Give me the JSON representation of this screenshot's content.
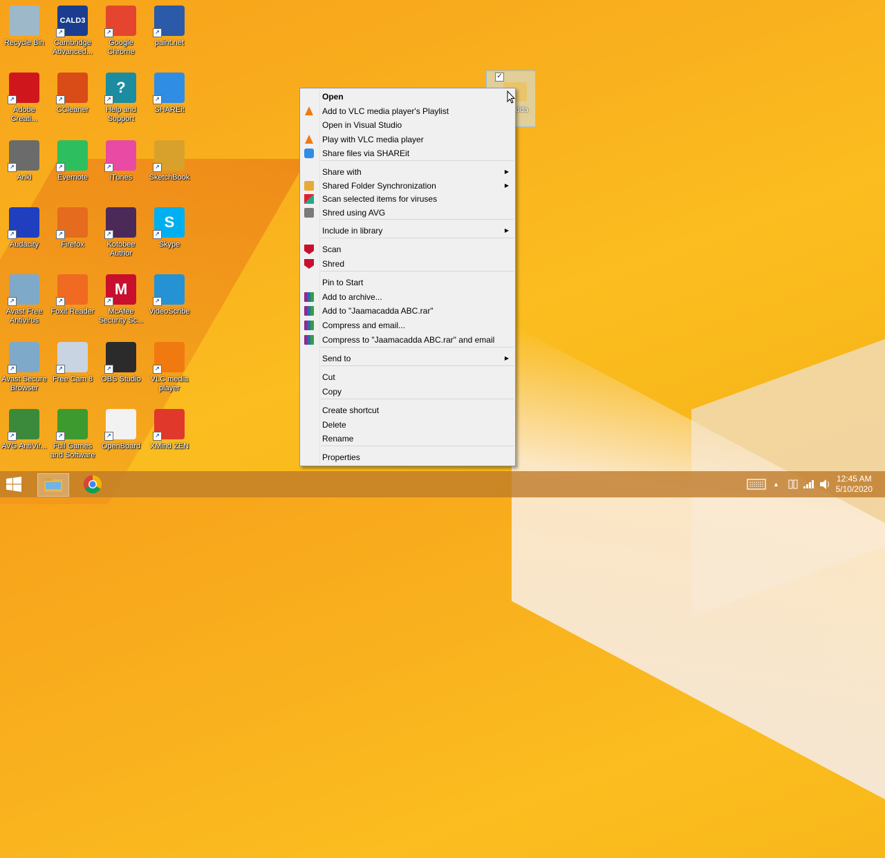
{
  "desktop": {
    "icons": [
      {
        "label": "Recycle Bin",
        "icon": "recycle-bin-icon",
        "color": "#9db8c9"
      },
      {
        "label": "Cambridge Advanced...",
        "icon": "cald3-icon",
        "color": "#1a3d8f",
        "badge": "CALD3"
      },
      {
        "label": "Google Chrome",
        "icon": "chrome-icon",
        "color": "#e5452f"
      },
      {
        "label": "paint.net",
        "icon": "paintnet-icon",
        "color": "#2a5aa8"
      },
      {
        "label": "Adobe Creati...",
        "icon": "adobe-cc-icon",
        "color": "#d0161d"
      },
      {
        "label": "CCleaner",
        "icon": "ccleaner-icon",
        "color": "#d94b17"
      },
      {
        "label": "Help and Support",
        "icon": "help-icon",
        "color": "#1c8ca0",
        "badge": "?"
      },
      {
        "label": "SHAREit",
        "icon": "shareit-icon",
        "color": "#2f8de4"
      },
      {
        "label": "Anki",
        "icon": "anki-icon",
        "color": "#6b6b6b"
      },
      {
        "label": "Evernote",
        "icon": "evernote-icon",
        "color": "#2dbe60"
      },
      {
        "label": "iTunes",
        "icon": "itunes-icon",
        "color": "#e94aa3"
      },
      {
        "label": "SketchBook",
        "icon": "sketchbook-icon",
        "color": "#d8a12b"
      },
      {
        "label": "Audacity",
        "icon": "audacity-icon",
        "color": "#1f3fbf"
      },
      {
        "label": "Firefox",
        "icon": "firefox-icon",
        "color": "#e56b1e"
      },
      {
        "label": "Kotobee Author",
        "icon": "kotobee-icon",
        "color": "#4b2a5a"
      },
      {
        "label": "Skype",
        "icon": "skype-icon",
        "color": "#00aff0",
        "badge": "S"
      },
      {
        "label": "Avast Free Antivirus",
        "icon": "avast-icon",
        "color": "#7fa9c9"
      },
      {
        "label": "Foxit Reader",
        "icon": "foxit-icon",
        "color": "#f06b21"
      },
      {
        "label": "McAfee Security Sc...",
        "icon": "mcafee-icon",
        "color": "#c8102e",
        "badge": "M"
      },
      {
        "label": "VideoScribe",
        "icon": "videoscribe-icon",
        "color": "#2592d3"
      },
      {
        "label": "Avast Secure Browser",
        "icon": "avast-browser-icon",
        "color": "#7fa9c9"
      },
      {
        "label": "Free Cam 8",
        "icon": "freecam-icon",
        "color": "#c8d4e2"
      },
      {
        "label": "OBS Studio",
        "icon": "obs-icon",
        "color": "#2b2b2b"
      },
      {
        "label": "VLC media player",
        "icon": "vlc-icon",
        "color": "#f07a10"
      },
      {
        "label": "AVG AntiVir...",
        "icon": "avg-icon",
        "color": "#3b8a3b"
      },
      {
        "label": "Full Games and Software",
        "icon": "games-icon",
        "color": "#3d9a2e"
      },
      {
        "label": "OpenBoard",
        "icon": "openboard-icon",
        "color": "#f2f2f2"
      },
      {
        "label": "XMind ZEN",
        "icon": "xmind-icon",
        "color": "#e0382b"
      }
    ],
    "selected_file": {
      "label": "cadda",
      "checked": "✓"
    }
  },
  "context_menu": {
    "items": [
      {
        "label": "Open",
        "bold": true,
        "icon": ""
      },
      {
        "label": "Add to VLC media player's Playlist",
        "icon": "vlc-icon"
      },
      {
        "label": "Open in Visual Studio",
        "icon": ""
      },
      {
        "label": "Play with VLC media player",
        "icon": "vlc-icon"
      },
      {
        "label": "Share files via SHAREit",
        "icon": "shareit-icon"
      },
      {
        "label": "Share with",
        "icon": "",
        "submenu": true
      },
      {
        "label": "Shared Folder Synchronization",
        "icon": "folder-sync-icon",
        "submenu": true
      },
      {
        "label": "Scan selected items for viruses",
        "icon": "avast-scan-icon"
      },
      {
        "label": "Shred using AVG",
        "icon": "shredder-icon"
      },
      {
        "label": "Include in library",
        "icon": "",
        "submenu": true
      },
      {
        "label": "Scan",
        "icon": "mcafee-icon"
      },
      {
        "label": "Shred",
        "icon": "mcafee-icon"
      },
      {
        "label": "Pin to Start",
        "icon": ""
      },
      {
        "label": "Add to archive...",
        "icon": "winrar-icon"
      },
      {
        "label": "Add to \"Jaamacadda ABC.rar\"",
        "icon": "winrar-icon"
      },
      {
        "label": "Compress and email...",
        "icon": "winrar-icon"
      },
      {
        "label": "Compress to \"Jaamacadda ABC.rar\" and email",
        "icon": "winrar-icon"
      },
      {
        "label": "Send to",
        "icon": "",
        "submenu": true
      },
      {
        "label": "Cut",
        "icon": ""
      },
      {
        "label": "Copy",
        "icon": ""
      },
      {
        "label": "Create shortcut",
        "icon": ""
      },
      {
        "label": "Delete",
        "icon": ""
      },
      {
        "label": "Rename",
        "icon": ""
      },
      {
        "label": "Properties",
        "icon": ""
      }
    ],
    "submenu_arrow": "▶"
  },
  "taskbar": {
    "start_icon": "windows-logo-icon",
    "pinned": [
      "file-explorer-icon",
      "chrome-icon"
    ],
    "tray_icons": [
      "keyboard-icon",
      "show-hidden-icons-icon",
      "network-icon",
      "signal-icon",
      "volume-icon"
    ],
    "tray_arrow": "▲",
    "clock": {
      "time": "12:45 AM",
      "date": "5/10/2020"
    }
  }
}
